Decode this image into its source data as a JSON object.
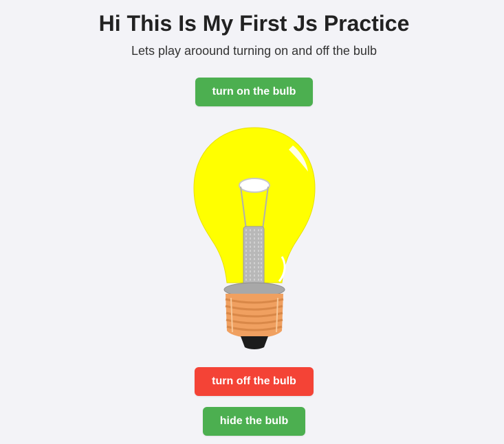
{
  "page": {
    "title": "Hi This Is My First Js Practice",
    "subtitle": "Lets play aroound turning on and off the bulb"
  },
  "buttons": {
    "turn_on": "turn on the bulb",
    "turn_off": "turn off the bulb",
    "hide": "hide the bulb"
  },
  "bulb": {
    "state": "on",
    "glass_color": "#ffff00",
    "base_color": "#f0a060"
  },
  "colors": {
    "background": "#f3f3f7",
    "green_button": "#4caf50",
    "red_button": "#f44336"
  }
}
